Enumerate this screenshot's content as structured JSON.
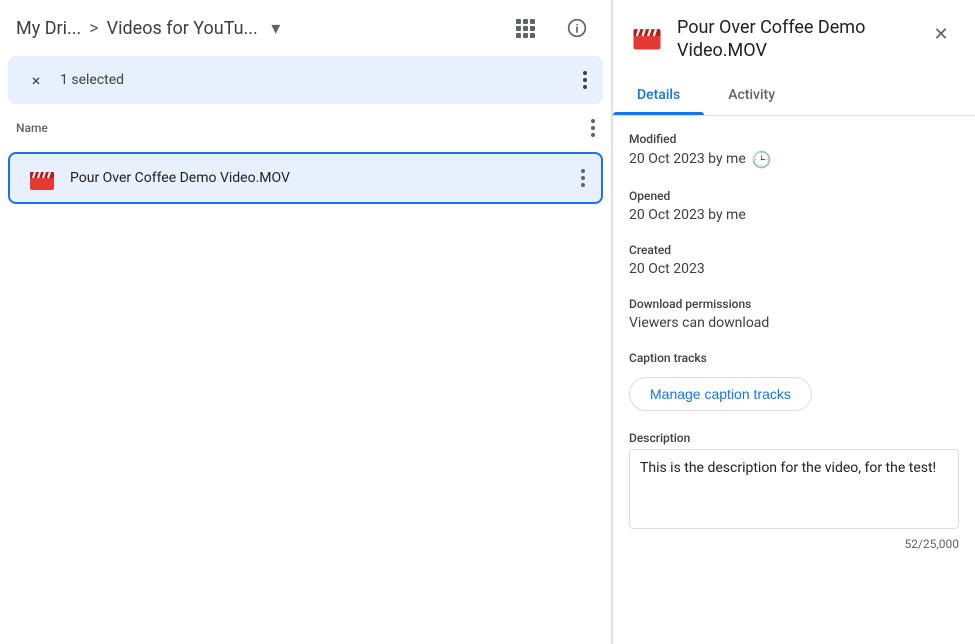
{
  "breadcrumb": {
    "root": "My Dri...",
    "separator": ">",
    "current": "Videos for YouTu...",
    "dropdown_label": "▼"
  },
  "header_icons": {
    "grid_label": "grid-view",
    "info_label": "info"
  },
  "selection_bar": {
    "close_label": "×",
    "count": "1 selected",
    "more_label": "⋮"
  },
  "file_list": {
    "header_name": "Name",
    "header_more": "⋮",
    "files": [
      {
        "id": "pour-over-video",
        "name": "Pour Over Coffee Demo Video.MOV",
        "icon": "video",
        "selected": true
      }
    ]
  },
  "detail_panel": {
    "title_line1": "Pour Over Coffee Demo",
    "title_line2": "Video.MOV",
    "close_label": "✕",
    "tabs": [
      {
        "id": "details",
        "label": "Details",
        "active": true
      },
      {
        "id": "activity",
        "label": "Activity",
        "active": false
      }
    ],
    "modified_label": "Modified",
    "modified_value": "20 Oct 2023 by me",
    "opened_label": "Opened",
    "opened_value": "20 Oct 2023 by me",
    "created_label": "Created",
    "created_value": "20 Oct 2023",
    "download_label": "Download permissions",
    "download_value": "Viewers can download",
    "caption_label": "Caption tracks",
    "manage_caption_btn": "Manage caption tracks",
    "description_label": "Description",
    "description_value": "This is the description for the video, for the test!",
    "char_count": "52/25,000"
  }
}
